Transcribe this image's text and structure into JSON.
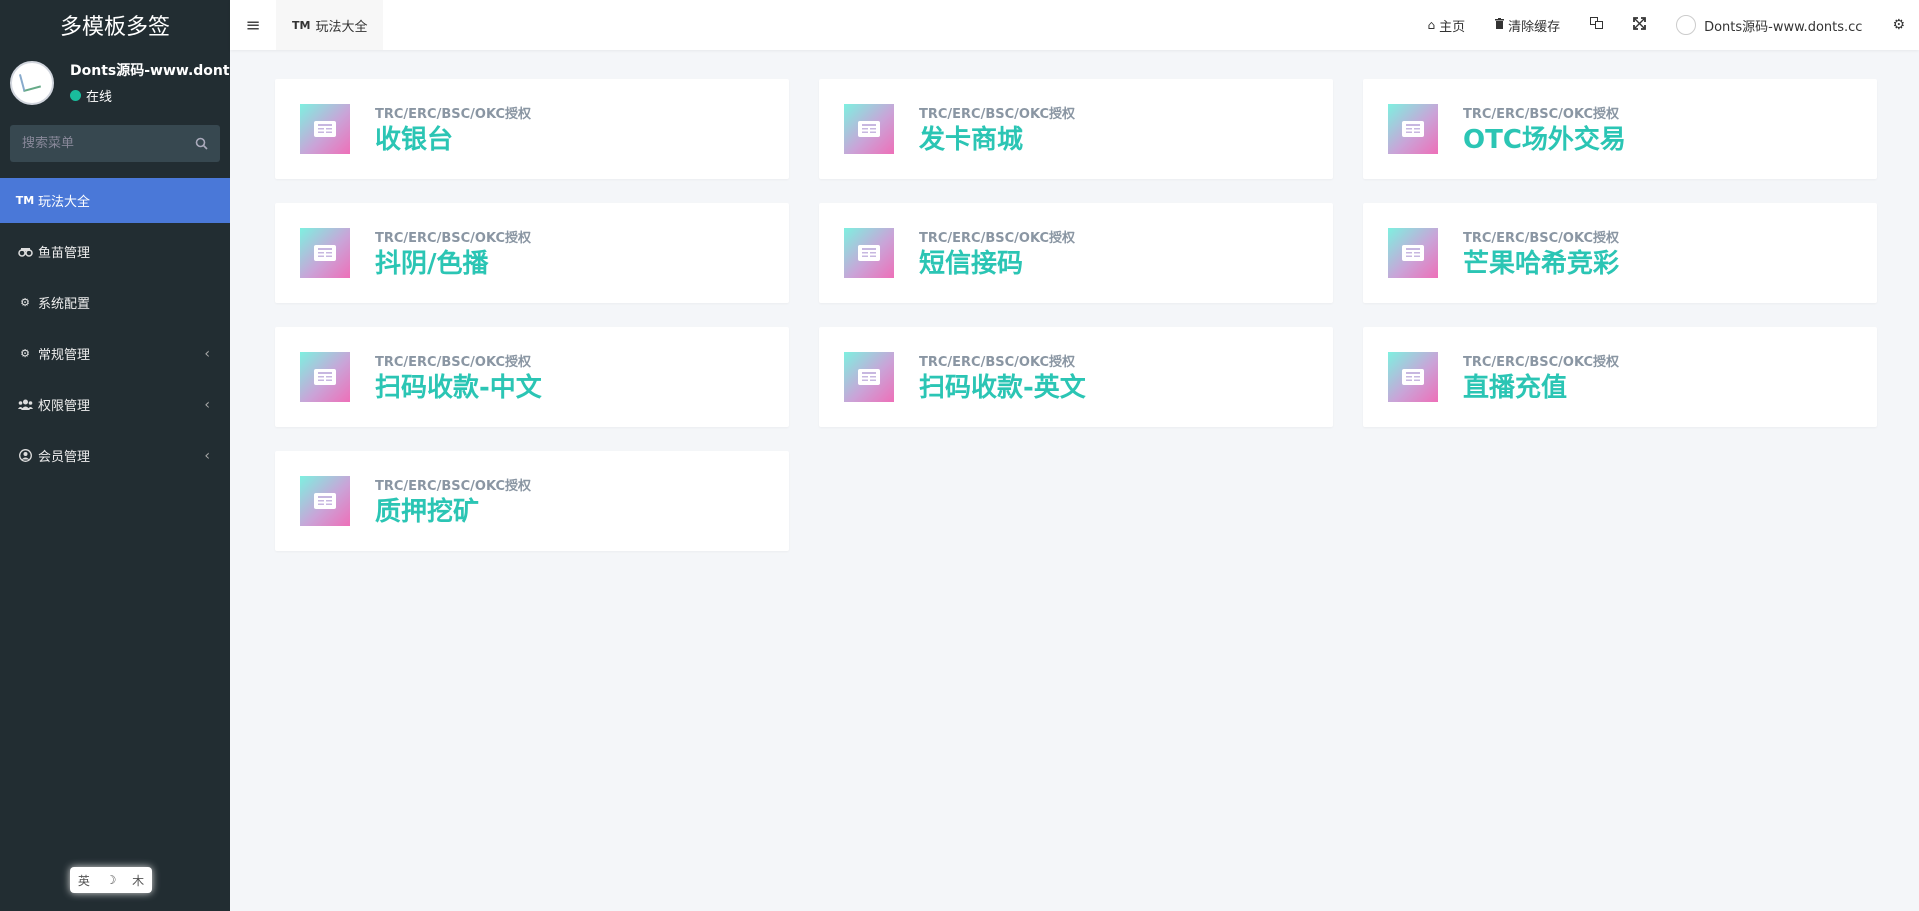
{
  "sidebar": {
    "brand": "多模板多签",
    "user": {
      "name": "Donts源码-www.donts.cc",
      "status": "在线"
    },
    "search": {
      "placeholder": "搜索菜单"
    },
    "menu": [
      {
        "label": "玩法大全",
        "icon": "tm-icon",
        "active": true
      },
      {
        "label": "鱼苗管理",
        "icon": "binoculars-icon"
      },
      {
        "label": "系统配置",
        "icon": "gear-icon"
      },
      {
        "label": "常规管理",
        "icon": "gears-icon",
        "chevron": "‹"
      },
      {
        "label": "权限管理",
        "icon": "users-icon",
        "chevron": "‹"
      },
      {
        "label": "会员管理",
        "icon": "user-circle-icon",
        "chevron": "‹"
      }
    ],
    "lang_pill": {
      "a": "英",
      "b": "☽",
      "c": "⽊"
    }
  },
  "topbar": {
    "tab_label": "玩法大全",
    "home": "主页",
    "clear_cache": "清除缓存",
    "username": "Donts源码-www.donts.cc"
  },
  "cards": [
    {
      "sub": "TRC/ERC/BSC/OKC授权",
      "title": "收银台"
    },
    {
      "sub": "TRC/ERC/BSC/OKC授权",
      "title": "发卡商城"
    },
    {
      "sub": "TRC/ERC/BSC/OKC授权",
      "title": "OTC场外交易"
    },
    {
      "sub": "TRC/ERC/BSC/OKC授权",
      "title": "抖阴/色播"
    },
    {
      "sub": "TRC/ERC/BSC/OKC授权",
      "title": "短信接码"
    },
    {
      "sub": "TRC/ERC/BSC/OKC授权",
      "title": "芒果哈希竞彩"
    },
    {
      "sub": "TRC/ERC/BSC/OKC授权",
      "title": "扫码收款-中文"
    },
    {
      "sub": "TRC/ERC/BSC/OKC授权",
      "title": "扫码收款-英文"
    },
    {
      "sub": "TRC/ERC/BSC/OKC授权",
      "title": "直播充值"
    },
    {
      "sub": "TRC/ERC/BSC/OKC授权",
      "title": "质押挖矿"
    }
  ],
  "colors": {
    "sidebar_bg": "#222d32",
    "accent": "#4a78d8",
    "card_title": "#2bc5b4",
    "online": "#1abc9c"
  }
}
